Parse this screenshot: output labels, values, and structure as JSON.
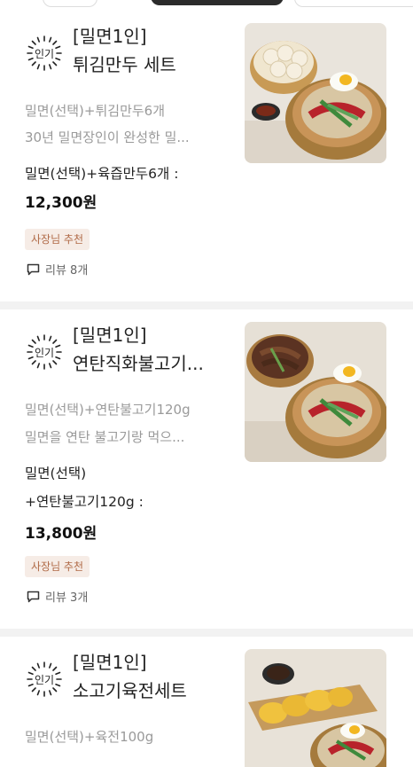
{
  "items": [
    {
      "badge": "인기",
      "title_line1": "[밀면1인]",
      "title_line2": "튀김만두 세트",
      "desc_line1": "밀면(선택)+튀김만두6개",
      "desc_line2": "30년 밀면장인이 완성한 밀...",
      "option_line1": "밀면(선택)+육즙만두6개 :",
      "option_line2": "",
      "price": "12,300원",
      "tag": "사장님 추천",
      "reviews": "리뷰 8개",
      "photo_icon": "naengmyeon-with-dumplings"
    },
    {
      "badge": "인기",
      "title_line1": "[밀면1인]",
      "title_line2": "연탄직화불고기...",
      "desc_line1": "밀면(선택)+연탄불고기120g",
      "desc_line2": "밀면을 연탄 불고기랑 먹으...",
      "option_line1": "밀면(선택)",
      "option_line2": "+연탄불고기120g :",
      "price": "13,800원",
      "tag": "사장님 추천",
      "reviews": "리뷰 3개",
      "photo_icon": "naengmyeon-with-bulgogi"
    },
    {
      "badge": "인기",
      "title_line1": "[밀면1인]",
      "title_line2": "소고기육전세트",
      "desc_line1": "밀면(선택)+육전100g",
      "photo_icon": "naengmyeon-with-yukjeon"
    }
  ],
  "colors": {
    "tag_bg": "#f6ece6",
    "tag_text": "#b06a47",
    "separator": "#f2f2f2",
    "desc_text": "#9a9a9a"
  }
}
